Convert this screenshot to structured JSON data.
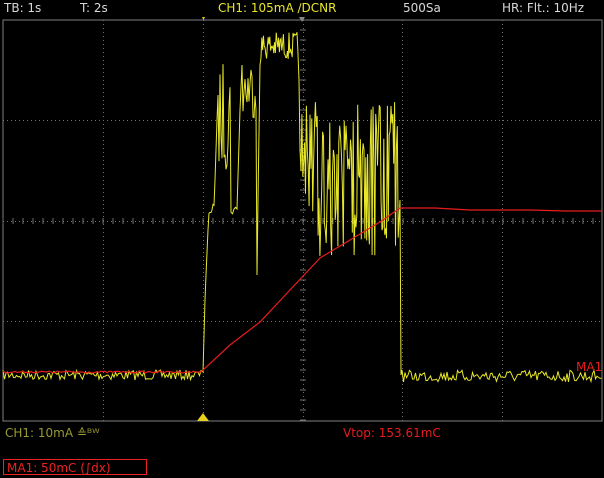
{
  "header": {
    "timebase": "TB: 1s",
    "trigger_time": "T: 2s",
    "channel": "CH1: 105mA ∕DCNR",
    "sample_rate": "500Sa",
    "hires": "HR: Flt.: 10Hz"
  },
  "footer": {
    "ch1_scale": "CH1: 10mA ≙ᴮᵂ",
    "vtop": "Vtop: 153.61mC",
    "math_label": "MA1: 50mC (∫dx)"
  },
  "trace_labels": {
    "math": "MA1"
  },
  "colors": {
    "ch1": "#e8e82a",
    "math": "#e81c1c",
    "grid": "#707070",
    "text": "#d8d8d8",
    "trigger_marker": "#e8d020"
  }
}
